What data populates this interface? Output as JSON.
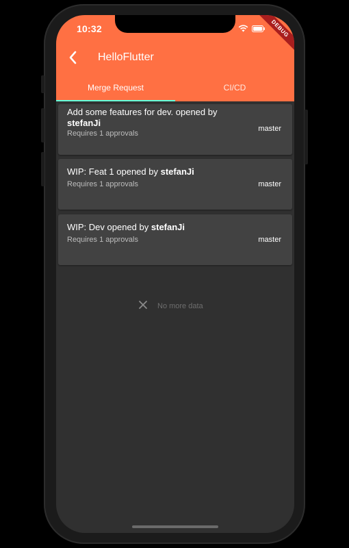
{
  "status_bar": {
    "time": "10:32",
    "debug_label": "DEBUG"
  },
  "app_bar": {
    "back_icon": "chevron-left-icon",
    "title": "HelloFlutter"
  },
  "tabs": [
    {
      "label": "Merge Request",
      "selected": true
    },
    {
      "label": "CI/CD",
      "selected": false
    }
  ],
  "merge_requests": [
    {
      "title": "Add some features for dev.",
      "opened_by": "opened by",
      "author": "stefanJi",
      "approvals": "Requires 1 approvals",
      "branch": "master"
    },
    {
      "title": "WIP: Feat 1",
      "opened_by": "opened by",
      "author": "stefanJi",
      "approvals": "Requires 1 approvals",
      "branch": "master"
    },
    {
      "title": "WIP: Dev",
      "opened_by": "opened by",
      "author": "stefanJi",
      "approvals": "Requires 1 approvals",
      "branch": "master"
    }
  ],
  "footer": {
    "icon": "close-icon",
    "text": "No more data"
  },
  "colors": {
    "app_bar": "#ff7043",
    "tab_indicator": "#64ffda",
    "background": "#303030",
    "card": "#424242"
  }
}
